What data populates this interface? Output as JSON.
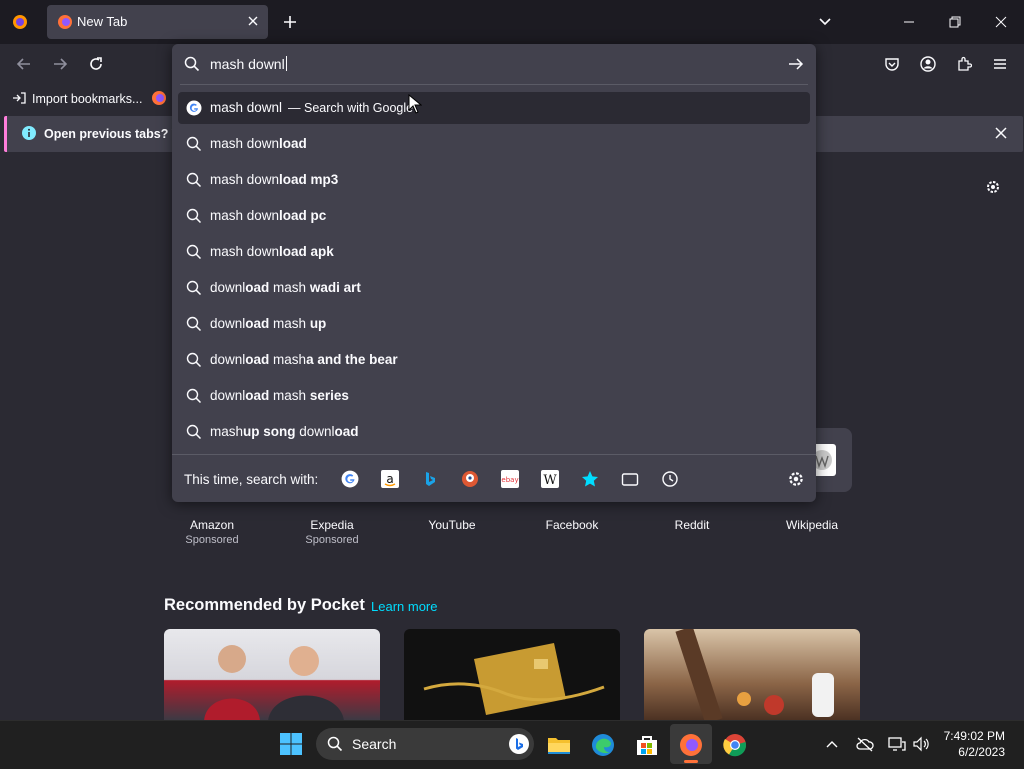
{
  "browser": {
    "tab": {
      "title": "New Tab"
    },
    "bookmarks": {
      "import_label": "Import bookmarks..."
    },
    "notification": {
      "text": "Open previous tabs? You"
    }
  },
  "urlbar": {
    "query": "mash downl",
    "suggestions": [
      {
        "typed": "mash downl",
        "rest": "",
        "action": "— Search with Google",
        "icon": "google-icon"
      },
      {
        "typed": "mash down",
        "rest": "load",
        "icon": "search-icon"
      },
      {
        "typed": "mash down",
        "rest": "load mp3",
        "icon": "search-icon"
      },
      {
        "typed": "mash down",
        "rest": "load pc",
        "icon": "search-icon"
      },
      {
        "typed": "mash down",
        "rest": "load apk",
        "icon": "search-icon"
      },
      {
        "typed": "downl",
        "rest": "oad",
        "typed2": " mash ",
        "rest2": "wadi art",
        "icon": "search-icon"
      },
      {
        "typed": "downl",
        "rest": "oad",
        "typed2": " mash ",
        "rest2": "up",
        "icon": "search-icon"
      },
      {
        "typed": "downl",
        "rest": "oad",
        "typed2": " mash",
        "rest2": "a and the bear",
        "icon": "search-icon"
      },
      {
        "typed": "downl",
        "rest": "oad",
        "typed2": " mash ",
        "rest2": "series",
        "icon": "search-icon"
      },
      {
        "typed": "mash",
        "rest": "up song",
        "typed2": " downl",
        "rest2": "oad",
        "icon": "search-icon"
      }
    ],
    "oneoff_label": "This time, search with:",
    "engines": [
      "google-icon",
      "amazon-icon",
      "bing-icon",
      "duckduckgo-icon",
      "ebay-icon",
      "wikipedia-icon",
      "bookmarks-icon",
      "tabs-icon",
      "history-icon"
    ]
  },
  "newtab": {
    "shortcuts": [
      {
        "label": "Amazon",
        "sponsor": "Sponsored"
      },
      {
        "label": "Expedia",
        "sponsor": "Sponsored"
      },
      {
        "label": "YouTube",
        "sponsor": ""
      },
      {
        "label": "Facebook",
        "sponsor": ""
      },
      {
        "label": "Reddit",
        "sponsor": ""
      },
      {
        "label": "Wikipedia",
        "sponsor": ""
      }
    ],
    "pocket_heading": "Recommended by Pocket",
    "pocket_link": "Learn more"
  },
  "taskbar": {
    "search_label": "Search",
    "time": "7:49:02 PM",
    "date": "6/2/2023"
  },
  "colors": {
    "accent": "#00ddff",
    "highlight": "#ff7edb",
    "panel": "#42414d",
    "page": "#2b2a33"
  }
}
